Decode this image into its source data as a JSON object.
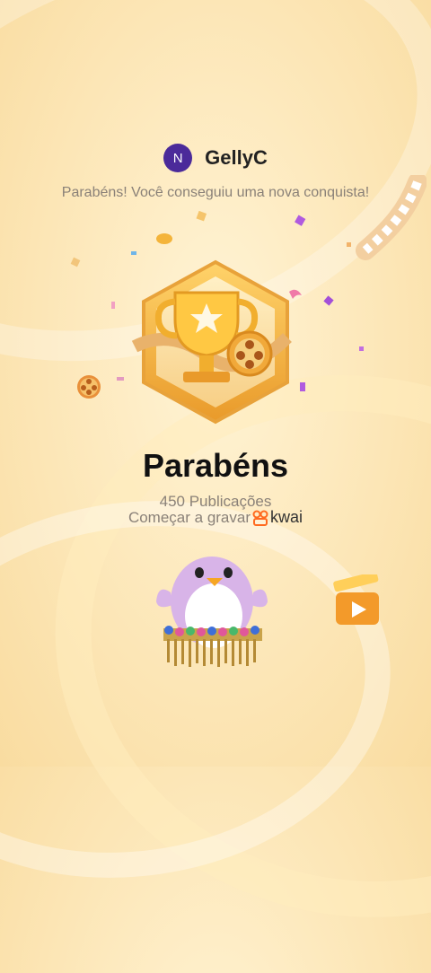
{
  "user": {
    "avatar_initial": "N",
    "name": "GellyC"
  },
  "message": "Parabéns! Você conseguiu uma nova conquista!",
  "achievement": {
    "title": "Parabéns",
    "count_text": "450 Publicações",
    "cta_text": "Começar a gravar",
    "brand": "kwai"
  },
  "colors": {
    "avatar": "#4b2a9a",
    "badge_gold": "#f4b43a",
    "kwai_orange": "#ff6a1f"
  }
}
